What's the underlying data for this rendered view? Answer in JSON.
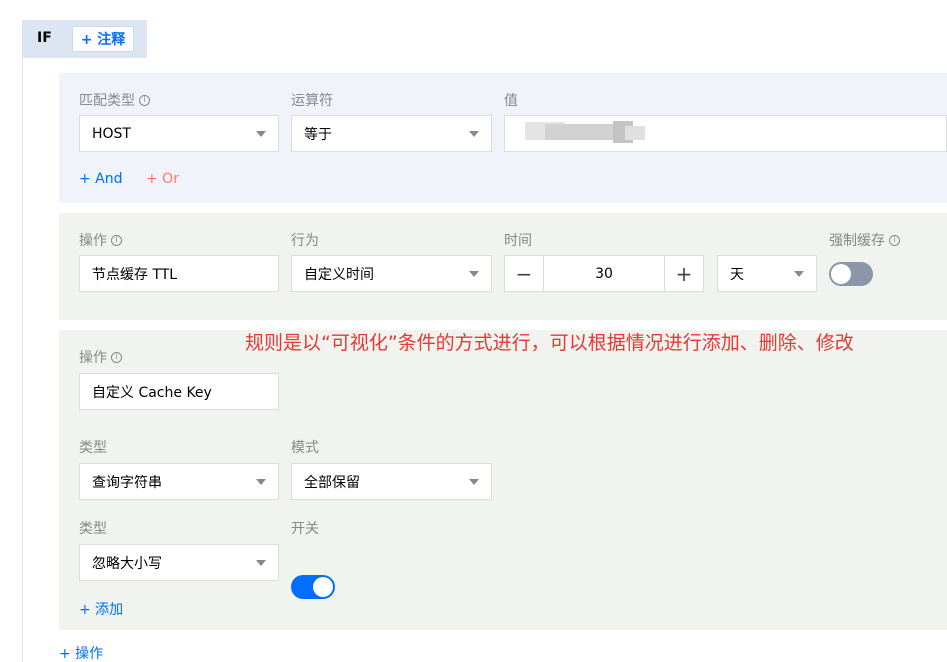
{
  "rule": {
    "if_label": "IF",
    "add_note": "+ 注释"
  },
  "condition": {
    "labels": {
      "match_type": "匹配类型",
      "operator": "运算符",
      "value": "值"
    },
    "match_type": "HOST",
    "operator": "等于",
    "value_masked": true,
    "add_and": "+ And",
    "add_or": "+ Or"
  },
  "operation_ttl": {
    "labels": {
      "operation": "操作",
      "behavior": "行为",
      "time": "时间",
      "force_cache": "强制缓存"
    },
    "operation": "节点缓存 TTL",
    "behavior": "自定义时间",
    "time_value": "30",
    "stepper_minus": "−",
    "stepper_plus": "+",
    "time_unit": "天",
    "force_cache_on": false
  },
  "operation_cache_key": {
    "labels": {
      "operation": "操作",
      "type": "类型",
      "mode": "模式",
      "type2": "类型",
      "switch": "开关"
    },
    "operation": "自定义 Cache Key",
    "type": "查询字符串",
    "mode": "全部保留",
    "type2": "忽略大小写",
    "switch_on": true,
    "add": "+ 添加"
  },
  "add_operation": "+ 操作",
  "annotation": "规则是以“可视化”条件的方式进行，可以根据情况进行添加、删除、修改",
  "colors": {
    "accent": "#006eff",
    "or_link": "#ff7a5c",
    "annotation": "#e53935",
    "condition_panel": "#f0f3f9",
    "operation_panel": "#f1f3ef",
    "toggle_off": "#8b96a8"
  },
  "icons": [
    "info-icon",
    "chevron-down-icon",
    "minus-icon",
    "plus-icon"
  ]
}
